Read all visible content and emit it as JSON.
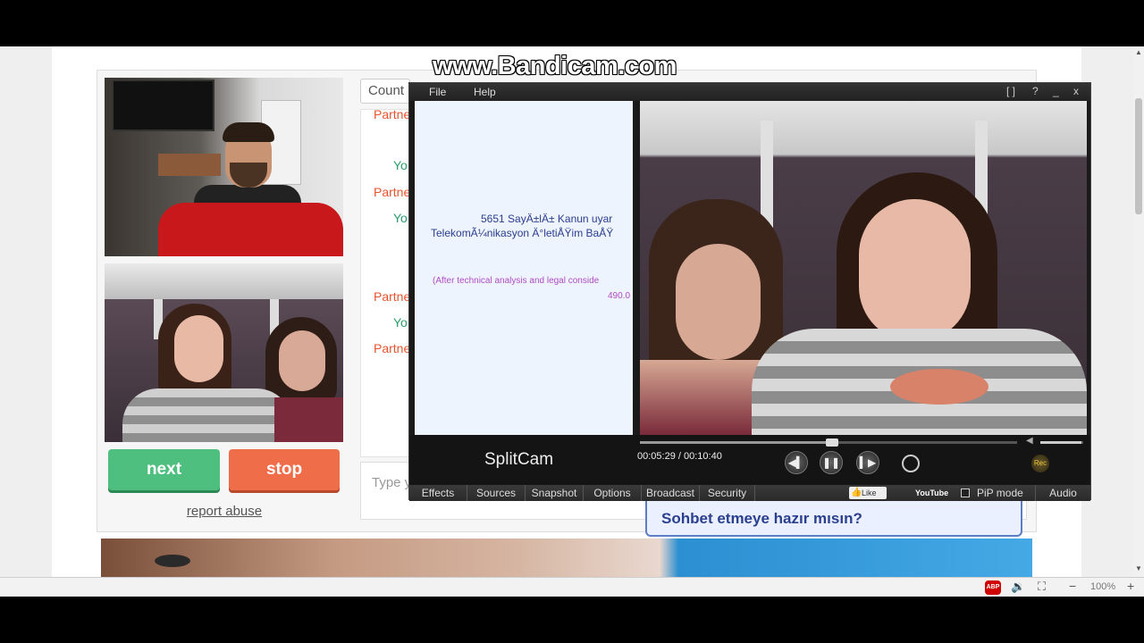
{
  "watermark": "www.Bandicam.com",
  "chat": {
    "next_label": "next",
    "stop_label": "stop",
    "report_label": "report abuse",
    "country_label": "Count",
    "type_placeholder": "Type y",
    "log": [
      {
        "who": "partner",
        "text": "Partne"
      },
      {
        "who": "you",
        "text": "Yo"
      },
      {
        "who": "partner",
        "text": "Partne"
      },
      {
        "who": "you",
        "text": "Yo"
      },
      {
        "who": "partner",
        "text": "Partne"
      },
      {
        "who": "you",
        "text": "Yo"
      },
      {
        "who": "partner",
        "text": "Partne"
      }
    ]
  },
  "ad": {
    "bubble_text": "Sohbet etmeye hazır mısın?"
  },
  "splitcam": {
    "menu": [
      "File",
      "Help"
    ],
    "window_controls": [
      "[ ]",
      "?",
      "_",
      "x"
    ],
    "notice_line1": "5651 SayÄ±lÄ± Kanun uyar",
    "notice_line2": "TelekomÃ¼nikasyon Ä°letiÅŸim BaÅŸ",
    "notice_line3": "(After technical analysis and legal conside",
    "notice_line4": "490.0",
    "logo": "SplitCam",
    "time": "00:05:29 / 00:10:40",
    "progress": 0.51,
    "volume": 0.95,
    "rec_label": "Rec",
    "tabs": [
      "Effects",
      "Sources",
      "Snapshot",
      "Options",
      "Broadcast",
      "Security"
    ],
    "like_label": "Like",
    "youtube_label": "YouTube",
    "pip_label": "PiP mode",
    "audio_label": "Audio"
  },
  "statusbar": {
    "zoom": "100%",
    "abp": "ABP"
  }
}
